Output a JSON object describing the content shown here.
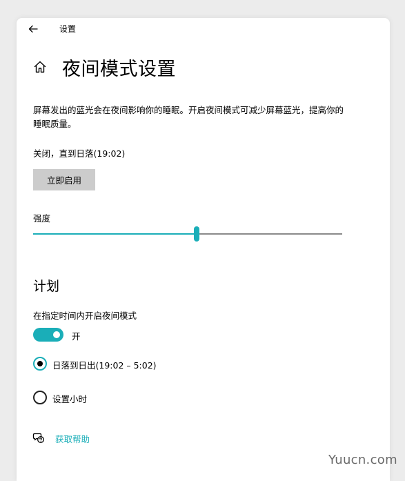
{
  "header": {
    "title": "设置"
  },
  "page": {
    "title": "夜间模式设置",
    "description": "屏幕发出的蓝光会在夜间影响你的睡眠。开启夜间模式可减少屏幕蓝光，提高你的睡眠质量。",
    "status": "关闭，直到日落(19:02)",
    "enable_button_label": "立即启用"
  },
  "strength": {
    "label": "强度",
    "value_percent": 53
  },
  "schedule": {
    "heading": "计划",
    "toggle_label": "在指定时间内开启夜间模式",
    "toggle_state": "开",
    "toggle_on": true,
    "options": [
      {
        "label": "日落到日出(19:02 – 5:02)",
        "selected": true
      },
      {
        "label": "设置小时",
        "selected": false
      }
    ]
  },
  "help": {
    "label": "获取帮助"
  },
  "watermark": {
    "text": "Yuucn.com"
  },
  "colors": {
    "accent": "#1aaeb8",
    "button_bg": "#cccccc",
    "background": "#ececec",
    "window": "#ffffff"
  },
  "icons": {
    "back": "arrow-left-icon",
    "home": "home-icon",
    "help": "chat-question-icon"
  }
}
